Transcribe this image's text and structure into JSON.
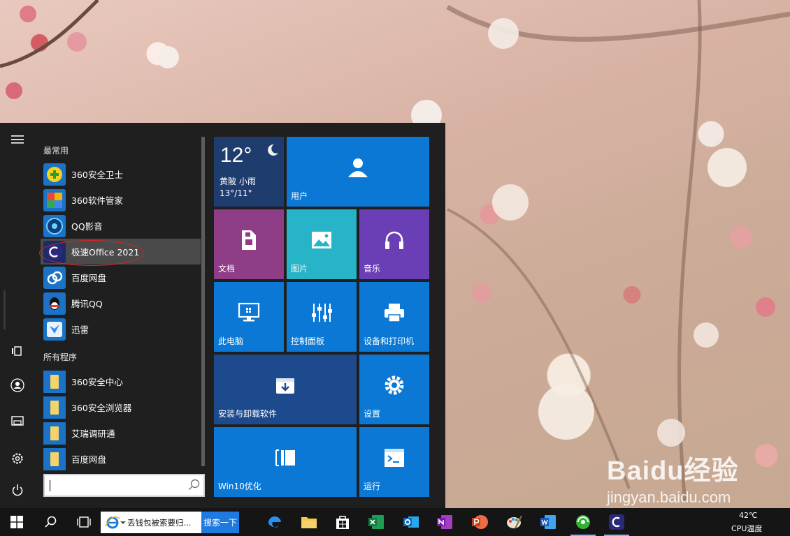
{
  "start_menu": {
    "frequent_heading": "最常用",
    "all_heading": "所有程序",
    "frequent_apps": [
      {
        "label": "360安全卫士",
        "icon": "360-safe-icon"
      },
      {
        "label": "360软件管家",
        "icon": "360-software-icon"
      },
      {
        "label": "QQ影音",
        "icon": "qq-player-icon"
      },
      {
        "label": "极速Office 2021",
        "icon": "office-icon"
      },
      {
        "label": "百度网盘",
        "icon": "baidu-netdisk-icon"
      },
      {
        "label": "腾讯QQ",
        "icon": "qq-icon"
      },
      {
        "label": "迅雷",
        "icon": "xunlei-icon"
      }
    ],
    "all_apps": [
      {
        "label": "360安全中心",
        "icon": "folder-icon"
      },
      {
        "label": "360安全浏览器",
        "icon": "folder-icon"
      },
      {
        "label": "艾瑞调研通",
        "icon": "folder-icon"
      },
      {
        "label": "百度网盘",
        "icon": "folder-icon"
      }
    ],
    "search_value": ""
  },
  "tiles": {
    "weather": {
      "temp": "12°",
      "location": "黄陂 小雨",
      "range": "13°/11°"
    },
    "user": "用户",
    "documents": "文档",
    "pictures": "图片",
    "music": "音乐",
    "this_pc": "此电脑",
    "control_panel": "控制面板",
    "devices_printers": "设备和打印机",
    "install_uninstall": "安装与卸载软件",
    "settings": "设置",
    "win10_optimize": "Win10优化",
    "run": "运行"
  },
  "taskbar": {
    "search_text": "丢钱包被索要归...",
    "search_button": "搜索一下",
    "tray_temp": "42℃",
    "tray_label": "CPU温度"
  },
  "watermark": {
    "main": "Baidu经验",
    "sub": "jingyan.baidu.com"
  },
  "colors": {
    "tile_blue": "#0a78d4",
    "tile_purple": "#8e3d86",
    "tile_teal": "#28b4c8",
    "tile_violet": "#6a3fb5",
    "tile_navy": "#1d4a8c",
    "weather": "#1f3c6e"
  }
}
